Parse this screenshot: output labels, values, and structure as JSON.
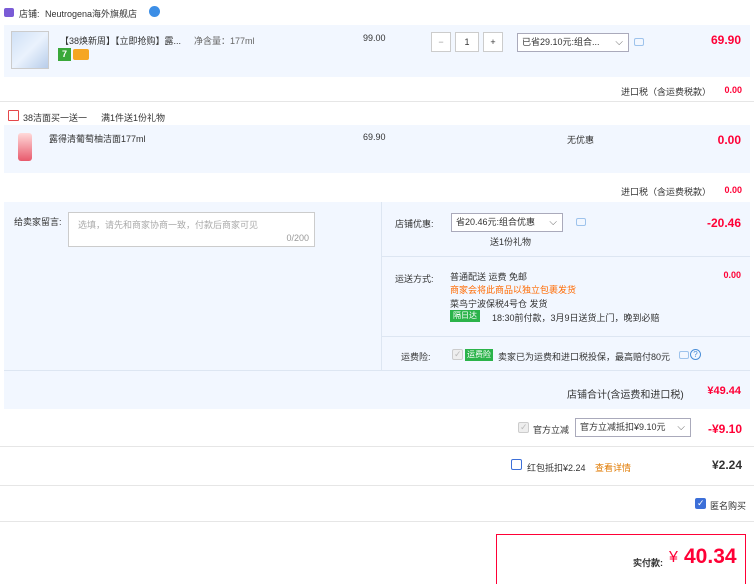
{
  "store": {
    "label": "店铺:",
    "name": "Neutrogena海外旗舰店"
  },
  "item1": {
    "title": "【38焕新周】【立即抢购】露...",
    "spec": "净含量：177ml",
    "price": "99.00",
    "qty": "1",
    "minus": "−",
    "plus": "+",
    "badge7": "7",
    "discount_select": "已省29.10元:组合...",
    "total": "69.90"
  },
  "tax1": {
    "label": "进口税（含运费税款）",
    "value": "0.00"
  },
  "promo": {
    "label": "38洁面买一送一",
    "desc": "满1件送1份礼物"
  },
  "item2": {
    "title": "露得清葡萄柚洁面177ml",
    "price": "69.90",
    "discount": "无优惠",
    "total": "0.00"
  },
  "tax2": {
    "label": "进口税（含运费税款）",
    "value": "0.00"
  },
  "message": {
    "label": "给卖家留言:",
    "placeholder": "选填，请先和商家协商一致，付款后商家可见",
    "counter": "0/200"
  },
  "store_discount": {
    "label": "店铺优惠:",
    "select": "省20.46元:组合优惠",
    "gift": "送1份礼物",
    "value": "-20.46"
  },
  "shipping": {
    "label": "运送方式:",
    "line1": "普通配送 运费 免邮",
    "line2": "商家会将此商品以独立包裹发货",
    "line3": "菜鸟宁波保税4号仓  发货",
    "tag": "隔日达",
    "line4": "18:30前付款，3月9日送货上门，晚到必赔",
    "value": "0.00"
  },
  "insurance": {
    "label": "运费险:",
    "tag": "运费险",
    "text": "卖家已为运费和进口税投保，最高赔付80元"
  },
  "store_total": {
    "label": "店铺合计(含运费和进口税)",
    "value": "¥49.44"
  },
  "official_discount": {
    "label": "官方立减",
    "select": "官方立减抵扣¥9.10元",
    "value": "-¥9.10"
  },
  "red_packet": {
    "label": "红包抵扣¥2.24",
    "link": "查看详情",
    "value": "¥2.24"
  },
  "anonymous": {
    "label": "匿名购买"
  },
  "payment": {
    "label": "实付款:",
    "currency": "¥",
    "value": "40.34"
  },
  "colors": {
    "accent": "#ff0036",
    "blue": "#3c6fd8",
    "panel": "#f2f7ff"
  }
}
